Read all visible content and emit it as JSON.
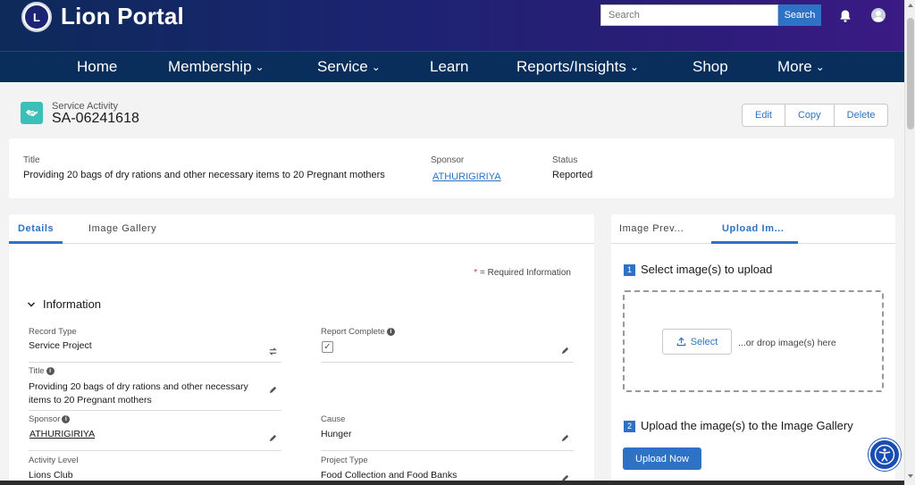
{
  "header": {
    "brand": "Lion Portal",
    "logo_text": "L",
    "search_placeholder": "Search",
    "search_button": "Search"
  },
  "nav": {
    "items": [
      {
        "label": "Home"
      },
      {
        "label": "Membership",
        "chevron": "⌄"
      },
      {
        "label": "Service",
        "chevron": "⌄"
      },
      {
        "label": "Learn"
      },
      {
        "label": "Reports/Insights",
        "chevron": "⌄"
      },
      {
        "label": "Shop"
      },
      {
        "label": "More",
        "chevron": "⌄"
      }
    ]
  },
  "record": {
    "type": "Service Activity",
    "name": "SA-06241618",
    "actions": [
      "Edit",
      "Copy",
      "Delete"
    ]
  },
  "highlights": {
    "title_label": "Title",
    "title_value": "Providing 20 bags of dry rations and other necessary items to 20 Pregnant mothers",
    "sponsor_label": "Sponsor",
    "sponsor_value": "ATHURIGIRIYA",
    "status_label": "Status",
    "status_value": "Reported"
  },
  "details": {
    "tabs": [
      "Details",
      "Image Gallery"
    ],
    "required_star": "*",
    "required_text": "= Required Information",
    "section_title": "Information",
    "fields": {
      "record_type_label": "Record Type",
      "record_type_value": "Service Project",
      "report_complete_label": "Report Complete",
      "title_label": "Title",
      "title_value": "Providing 20 bags of dry rations and other necessary items to 20 Pregnant mothers",
      "sponsor_label": "Sponsor",
      "sponsor_value": "ATHURIGIRIYA",
      "cause_label": "Cause",
      "cause_value": "Hunger",
      "activity_level_label": "Activity Level",
      "activity_level_value": "Lions Club",
      "project_type_label": "Project Type",
      "project_type_value": "Food Collection and Food Banks"
    }
  },
  "upload": {
    "tabs": [
      "Image Prev...",
      "Upload Im..."
    ],
    "step1_num": "1",
    "step1_text": "Select image(s) to upload",
    "select_button": "Select",
    "drop_text": "...or drop image(s) here",
    "step2_num": "2",
    "step2_text": "Upload the image(s) to the Image Gallery",
    "upload_button": "Upload Now"
  },
  "colors": {
    "accent": "#2e72c6",
    "nav_bg": "#0a2e5c",
    "record_icon": "#3bc0b7"
  },
  "icons": [
    "lions-logo-icon",
    "bell-icon",
    "user-icon",
    "handshake-icon",
    "chevron-down-icon",
    "info-icon",
    "pencil-icon",
    "switch-icon",
    "upload-icon",
    "accessibility-icon"
  ]
}
